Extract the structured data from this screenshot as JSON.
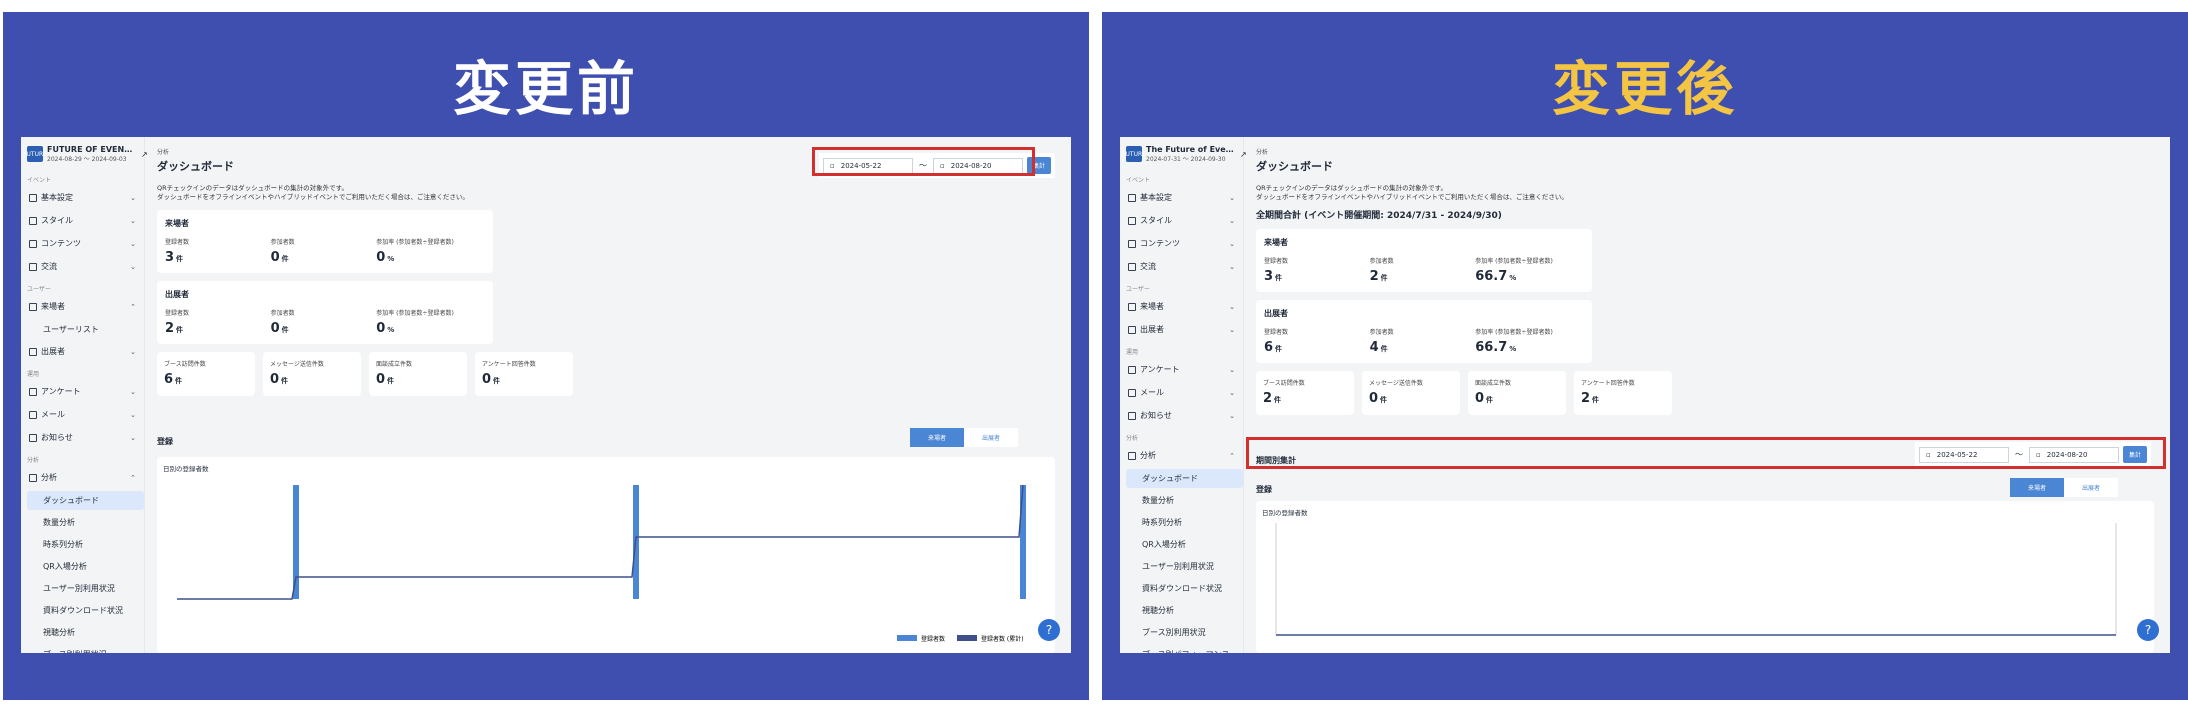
{
  "before": {
    "title": "変更前",
    "title_color": "#ffffff",
    "event_name": "FUTURE OF EVEN…",
    "event_dates": "2024-08-29 〜 2024-09-03"
  },
  "after": {
    "title": "変更後",
    "title_color": "#f4c542",
    "event_name": "The Future of Eve…",
    "event_dates": "2024-07-31 〜 2024-09-30",
    "total_label": "全期間合計 (イベント開催期間: 2024/7/31 - 2024/9/30)",
    "period_label": "期間別集計"
  },
  "common": {
    "logo": "FUTURE",
    "breadcrumb": "分析",
    "page_title": "ダッシュボード",
    "note1": "QRチェックインのデータはダッシュボードの集計の対象外です。",
    "note2": "ダッシュボードをオフラインイベントやハイブリッドイベントでご利用いただく場合は、ご注意ください。",
    "date_from": "2024-05-22",
    "date_to": "2024-08-20",
    "tilde": "〜",
    "agg_button": "集計",
    "visitors": "来場者",
    "exhibitors": "出展者",
    "registered": "登録者数",
    "participants": "参加者数",
    "rate": "参加率 (参加者数÷登録者数)",
    "unit_count": "件",
    "unit_pct": "%",
    "booth": "ブース訪問件数",
    "message": "メッセージ送信件数",
    "deal": "面談成立件数",
    "survey": "アンケート回答件数",
    "reg_section": "登録",
    "tab_visitor": "来場者",
    "tab_exhibitor": "出展者",
    "chart_title": "日別の登録者数",
    "legend1": "登録者数",
    "legend2": "登録者数 (累計)",
    "help": "?"
  },
  "side_before": {
    "sec_event": "イベント",
    "basic": "基本設定",
    "style": "スタイル",
    "content": "コンテンツ",
    "exchange": "交流",
    "sec_user": "ユーザー",
    "visitor": "来場者",
    "userlist": "ユーザーリスト",
    "exhibitor": "出展者",
    "sec_op": "運用",
    "survey": "アンケート",
    "mail": "メール",
    "notice": "お知らせ",
    "sec_an": "分析",
    "analysis": "分析",
    "dash": "ダッシュボード",
    "count": "数量分析",
    "ts": "時系列分析",
    "qr": "QR入場分析",
    "usage": "ユーザー別利用状況",
    "download": "資料ダウンロード状況",
    "watch": "視聴分析",
    "booth": "ブース別利用状況"
  },
  "side_after": {
    "sec_event": "イベント",
    "basic": "基本設定",
    "style": "スタイル",
    "content": "コンテンツ",
    "exchange": "交流",
    "sec_user": "ユーザー",
    "visitor": "来場者",
    "exhibitor": "出展者",
    "sec_op": "運用",
    "survey": "アンケート",
    "mail": "メール",
    "notice": "お知らせ",
    "sec_an": "分析",
    "analysis": "分析",
    "dash": "ダッシュボード",
    "count": "数量分析",
    "ts": "時系列分析",
    "qr": "QR入場分析",
    "usage": "ユーザー別利用状況",
    "download": "資料ダウンロード状況",
    "watch": "視聴分析",
    "booth": "ブース別利用状況",
    "perf": "ブース別パフォーマンス"
  },
  "vals_before": {
    "v_reg": "3",
    "v_par": "0",
    "v_rate": "0",
    "e_reg": "2",
    "e_par": "0",
    "e_rate": "0",
    "booth": "6",
    "msg": "0",
    "deal": "0",
    "survey": "0"
  },
  "vals_after": {
    "v_reg": "3",
    "v_par": "2",
    "v_rate": "66.7",
    "e_reg": "6",
    "e_par": "4",
    "e_rate": "66.7",
    "booth": "2",
    "msg": "0",
    "deal": "0",
    "survey": "2"
  },
  "colors": {
    "panel": "#3f4fb0",
    "highlight": "#d32f2f",
    "accent": "#4a86d4"
  }
}
